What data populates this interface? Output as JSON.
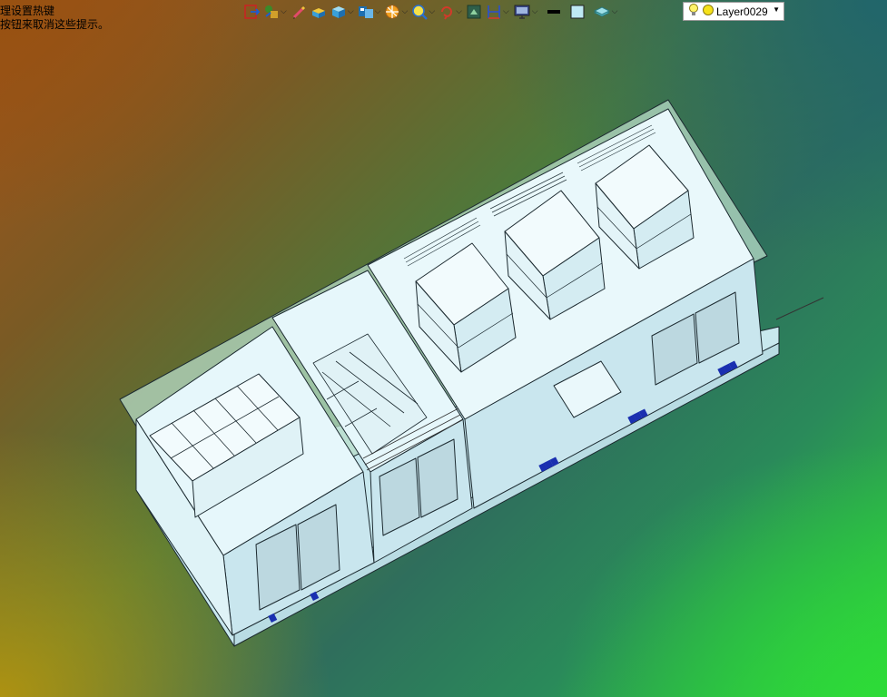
{
  "hint": {
    "line1": "理设置热键",
    "line2": "按钮来取消这些提示。"
  },
  "toolbar": {
    "buttons": [
      {
        "icon": "exit-sketch-icon",
        "has_dropdown": false
      },
      {
        "icon": "smart-dimension-icon",
        "has_dropdown": true
      },
      {
        "icon": "pencil-sketch-icon",
        "has_dropdown": false
      },
      {
        "icon": "extrude-boss-icon",
        "has_dropdown": false
      },
      {
        "icon": "view-cube-icon",
        "has_dropdown": true
      },
      {
        "icon": "standard-views-icon",
        "has_dropdown": true
      },
      {
        "icon": "section-view-icon",
        "has_dropdown": true
      },
      {
        "icon": "zoom-to-fit-icon",
        "has_dropdown": true
      },
      {
        "icon": "rotate-view-icon",
        "has_dropdown": true
      },
      {
        "icon": "display-style-icon",
        "has_dropdown": false
      },
      {
        "icon": "dimension-icon",
        "has_dropdown": true
      },
      {
        "icon": "monitor-display-icon",
        "has_dropdown": true
      },
      {
        "icon": "line-color-icon",
        "has_dropdown": false
      },
      {
        "icon": "fill-color-icon",
        "has_dropdown": false
      },
      {
        "icon": "layer-properties-icon",
        "has_dropdown": true
      }
    ],
    "layer": {
      "name": "Layer0029",
      "bulb_icon": "lightbulb-icon",
      "color_icon": "yellow-dot-icon"
    }
  },
  "colors": {
    "model_fill": "#d8f1f6",
    "model_stroke": "#1c2a30",
    "roof_tint": "#b8dcc8",
    "yellow": "#f6e21a"
  }
}
